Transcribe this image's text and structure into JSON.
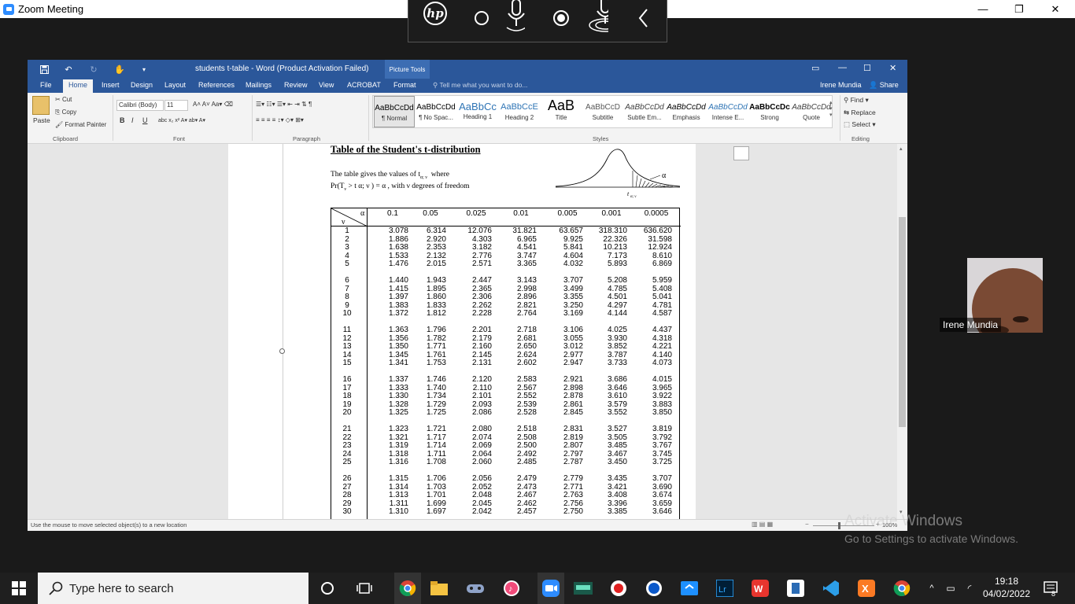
{
  "zoom": {
    "title": "Zoom Meeting",
    "controls": {
      "minimize": "—",
      "restore": "❐",
      "close": "✕"
    }
  },
  "hp_toolbar": {
    "logo": "hp"
  },
  "word": {
    "title": "students t-table - Word (Product Activation Failed)",
    "picture_tools": "Picture Tools",
    "tabs": [
      "File",
      "Home",
      "Insert",
      "Design",
      "Layout",
      "References",
      "Mailings",
      "Review",
      "View",
      "ACROBAT",
      "Format"
    ],
    "active_tab": "Home",
    "tell_me": "Tell me what you want to do...",
    "user": "Irene Mundia",
    "share": "Share",
    "ribbon": {
      "clipboard": {
        "paste": "Paste",
        "cut": "Cut",
        "copy": "Copy",
        "format_painter": "Format Painter",
        "label": "Clipboard"
      },
      "font": {
        "name": "Calibri (Body)",
        "size": "11",
        "label": "Font"
      },
      "paragraph": {
        "label": "Paragraph"
      },
      "styles": {
        "label": "Styles",
        "items": [
          {
            "sample": "AaBbCcDd",
            "name": "¶ Normal"
          },
          {
            "sample": "AaBbCcDd",
            "name": "¶ No Spac..."
          },
          {
            "sample": "AaBbCc",
            "name": "Heading 1"
          },
          {
            "sample": "AaBbCcE",
            "name": "Heading 2"
          },
          {
            "sample": "AaB",
            "name": "Title"
          },
          {
            "sample": "AaBbCcD",
            "name": "Subtitle"
          },
          {
            "sample": "AaBbCcDd",
            "name": "Subtle Em..."
          },
          {
            "sample": "AaBbCcDd",
            "name": "Emphasis"
          },
          {
            "sample": "AaBbCcDd",
            "name": "Intense E..."
          },
          {
            "sample": "AaBbCcDc",
            "name": "Strong"
          },
          {
            "sample": "AaBbCcDd",
            "name": "Quote"
          }
        ]
      },
      "editing": {
        "find": "Find",
        "replace": "Replace",
        "select": "Select",
        "label": "Editing"
      }
    },
    "status": "Use the mouse to move selected object(s) to a new location",
    "zoom_level": "100%",
    "document": {
      "title": "Table of the Student's t-distribution",
      "desc_line1": "The table gives the values of t",
      "desc_line1_sub": "α; ν",
      "desc_line1_end": "where",
      "desc_line2": "Pr(T",
      "desc_line2_rest": " > t α; ν ) = α , with  ν  degrees of freedom",
      "curve_alpha": "α",
      "curve_t": "t",
      "curve_t_sub": "α; ν",
      "table": {
        "alpha_symbol": "α",
        "nu_symbol": "ν",
        "alphas": [
          "0.1",
          "0.05",
          "0.025",
          "0.01",
          "0.005",
          "0.001",
          "0.0005"
        ],
        "rows": [
          [
            "1",
            "3.078",
            "6.314",
            "12.076",
            "31.821",
            "63.657",
            "318.310",
            "636.620"
          ],
          [
            "2",
            "1.886",
            "2.920",
            "4.303",
            "6.965",
            "9.925",
            "22.326",
            "31.598"
          ],
          [
            "3",
            "1.638",
            "2.353",
            "3.182",
            "4.541",
            "5.841",
            "10.213",
            "12.924"
          ],
          [
            "4",
            "1.533",
            "2.132",
            "2.776",
            "3.747",
            "4.604",
            "7.173",
            "8.610"
          ],
          [
            "5",
            "1.476",
            "2.015",
            "2.571",
            "3.365",
            "4.032",
            "5.893",
            "6.869"
          ],
          [
            "6",
            "1.440",
            "1.943",
            "2.447",
            "3.143",
            "3.707",
            "5.208",
            "5.959"
          ],
          [
            "7",
            "1.415",
            "1.895",
            "2.365",
            "2.998",
            "3.499",
            "4.785",
            "5.408"
          ],
          [
            "8",
            "1.397",
            "1.860",
            "2.306",
            "2.896",
            "3.355",
            "4.501",
            "5.041"
          ],
          [
            "9",
            "1.383",
            "1.833",
            "2.262",
            "2.821",
            "3.250",
            "4.297",
            "4.781"
          ],
          [
            "10",
            "1.372",
            "1.812",
            "2.228",
            "2.764",
            "3.169",
            "4.144",
            "4.587"
          ],
          [
            "11",
            "1.363",
            "1.796",
            "2.201",
            "2.718",
            "3.106",
            "4.025",
            "4.437"
          ],
          [
            "12",
            "1.356",
            "1.782",
            "2.179",
            "2.681",
            "3.055",
            "3.930",
            "4.318"
          ],
          [
            "13",
            "1.350",
            "1.771",
            "2.160",
            "2.650",
            "3.012",
            "3.852",
            "4.221"
          ],
          [
            "14",
            "1.345",
            "1.761",
            "2.145",
            "2.624",
            "2.977",
            "3.787",
            "4.140"
          ],
          [
            "15",
            "1.341",
            "1.753",
            "2.131",
            "2.602",
            "2.947",
            "3.733",
            "4.073"
          ],
          [
            "16",
            "1.337",
            "1.746",
            "2.120",
            "2.583",
            "2.921",
            "3.686",
            "4.015"
          ],
          [
            "17",
            "1.333",
            "1.740",
            "2.110",
            "2.567",
            "2.898",
            "3.646",
            "3.965"
          ],
          [
            "18",
            "1.330",
            "1.734",
            "2.101",
            "2.552",
            "2.878",
            "3.610",
            "3.922"
          ],
          [
            "19",
            "1.328",
            "1.729",
            "2.093",
            "2.539",
            "2.861",
            "3.579",
            "3.883"
          ],
          [
            "20",
            "1.325",
            "1.725",
            "2.086",
            "2.528",
            "2.845",
            "3.552",
            "3.850"
          ],
          [
            "21",
            "1.323",
            "1.721",
            "2.080",
            "2.518",
            "2.831",
            "3.527",
            "3.819"
          ],
          [
            "22",
            "1.321",
            "1.717",
            "2.074",
            "2.508",
            "2.819",
            "3.505",
            "3.792"
          ],
          [
            "23",
            "1.319",
            "1.714",
            "2.069",
            "2.500",
            "2.807",
            "3.485",
            "3.767"
          ],
          [
            "24",
            "1.318",
            "1.711",
            "2.064",
            "2.492",
            "2.797",
            "3.467",
            "3.745"
          ],
          [
            "25",
            "1.316",
            "1.708",
            "2.060",
            "2.485",
            "2.787",
            "3.450",
            "3.725"
          ],
          [
            "26",
            "1.315",
            "1.706",
            "2.056",
            "2.479",
            "2.779",
            "3.435",
            "3.707"
          ],
          [
            "27",
            "1.314",
            "1.703",
            "2.052",
            "2.473",
            "2.771",
            "3.421",
            "3.690"
          ],
          [
            "28",
            "1.313",
            "1.701",
            "2.048",
            "2.467",
            "2.763",
            "3.408",
            "3.674"
          ],
          [
            "29",
            "1.311",
            "1.699",
            "2.045",
            "2.462",
            "2.756",
            "3.396",
            "3.659"
          ],
          [
            "30",
            "1.310",
            "1.697",
            "2.042",
            "2.457",
            "2.750",
            "3.385",
            "3.646"
          ]
        ]
      }
    }
  },
  "participant": {
    "name": "Irene Mundia"
  },
  "activation": {
    "line1": "Activate Windows",
    "line2": "Go to Settings to activate Windows."
  },
  "taskbar": {
    "search_placeholder": "Type here to search",
    "time": "19:18",
    "date": "04/02/2022",
    "notification_count": "8"
  }
}
